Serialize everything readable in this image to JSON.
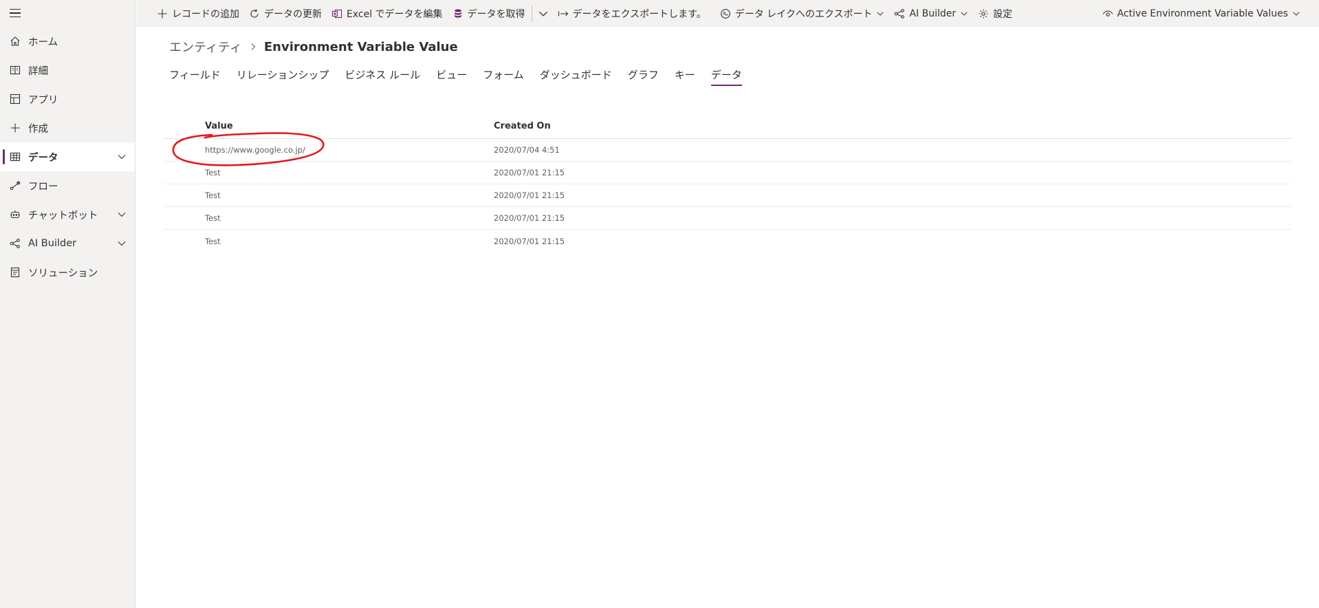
{
  "sidebar": {
    "items": [
      {
        "label": "ホーム",
        "icon": "home-icon"
      },
      {
        "label": "詳細",
        "icon": "book-icon"
      },
      {
        "label": "アプリ",
        "icon": "apps-icon"
      },
      {
        "label": "作成",
        "icon": "plus-icon"
      },
      {
        "label": "データ",
        "icon": "table-icon",
        "active": true
      },
      {
        "label": "フロー",
        "icon": "flow-icon"
      },
      {
        "label": "チャットボット",
        "icon": "chatbot-icon"
      },
      {
        "label": "AI Builder",
        "icon": "ai-builder-icon"
      },
      {
        "label": "ソリューション",
        "icon": "solution-icon"
      }
    ]
  },
  "commandbar": {
    "add_record": "レコードの追加",
    "refresh": "データの更新",
    "edit_excel": "Excel でデータを編集",
    "get_data": "データを取得",
    "export": "データをエクスポートします。",
    "export_lake": "データ レイクへのエクスポート",
    "ai_builder": "AI Builder",
    "settings": "設定",
    "view_selector": "Active Environment Variable Values"
  },
  "breadcrumb": {
    "parent": "エンティティ",
    "current": "Environment Variable Value"
  },
  "tabs": [
    "フィールド",
    "リレーションシップ",
    "ビジネス ルール",
    "ビュー",
    "フォーム",
    "ダッシュボード",
    "グラフ",
    "キー",
    "データ"
  ],
  "grid": {
    "columns": [
      "Value",
      "Created On"
    ],
    "rows": [
      [
        "https://www.google.co.jp/",
        "2020/07/04 4:51"
      ],
      [
        "Test",
        "2020/07/01 21:15"
      ],
      [
        "Test",
        "2020/07/01 21:15"
      ],
      [
        "Test",
        "2020/07/01 21:15"
      ],
      [
        "Test",
        "2020/07/01 21:15"
      ]
    ]
  },
  "colors": {
    "accent": "#742774",
    "annotation": "#e8141b"
  }
}
